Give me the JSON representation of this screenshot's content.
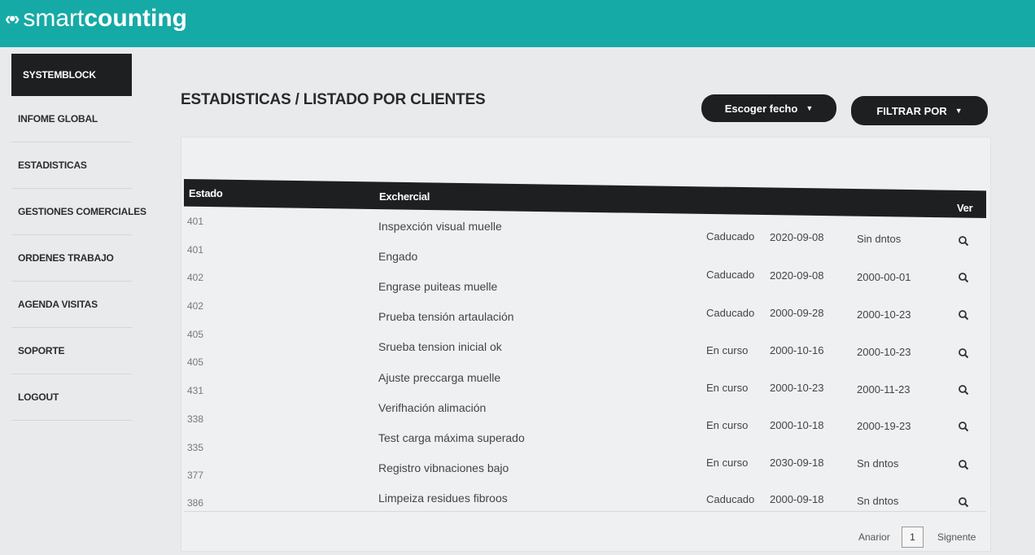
{
  "app": {
    "logo_mark": "‹•›",
    "logo_light": "smart",
    "logo_bold": "counting"
  },
  "sidebar": {
    "items": [
      {
        "label": "SYSTEMBLOCK"
      },
      {
        "label": "INFOME GLOBAL"
      },
      {
        "label": "ESTADISTICAS"
      },
      {
        "label": "GESTIONES COMERCIALES"
      },
      {
        "label": "ORDENES TRABAJO"
      },
      {
        "label": "AGENDA VISITAS"
      },
      {
        "label": "SOPORTE"
      },
      {
        "label": "LOGOUT"
      }
    ]
  },
  "page": {
    "title": "ESTADISTICAS / LISTADO POR CLIENTES",
    "date_button": "Escoger fecho",
    "filter_button": "FILTRAR POR"
  },
  "table": {
    "headers": {
      "estado": "Estado",
      "exchercial": "Exchercial",
      "ver": "Ver"
    },
    "estado_col": [
      "401",
      "401",
      "402",
      "402",
      "405",
      "405",
      "431",
      "338",
      "335",
      "377",
      "386"
    ],
    "exchercial_col": [
      "Inspexción visual muelle",
      "Engado",
      "Engrase puiteas muelle",
      "Prueba tensión artaulación",
      "Srueba tension inicial ok",
      "Ajuste preccarga muelle",
      "Verifhación alimación",
      "Test carga máxima superado",
      "Registro vibnaciones bajo",
      "Limpeiza residues fibroos"
    ],
    "status_rows": [
      {
        "status": "Caducado",
        "date1": "2020-09-08",
        "date2": "Sin dntos"
      },
      {
        "status": "Caducado",
        "date1": "2020-09-08",
        "date2": "2000-00-01"
      },
      {
        "status": "Caducado",
        "date1": "2000-09-28",
        "date2": "2000-10-23"
      },
      {
        "status": "En curso",
        "date1": "2000-10-16",
        "date2": "2000-10-23"
      },
      {
        "status": "En curso",
        "date1": "2000-10-23",
        "date2": "2000-11-23"
      },
      {
        "status": "En curso",
        "date1": "2000-10-18",
        "date2": "2000-19-23"
      },
      {
        "status": "En curso",
        "date1": "2030-09-18",
        "date2": "Sn dntos"
      },
      {
        "status": "Caducado",
        "date1": "2000-09-18",
        "date2": "Sn dntos"
      }
    ]
  },
  "pager": {
    "prev": "Anarior",
    "page": "1",
    "next": "Signente"
  },
  "colors": {
    "topbar": "#16aaa6",
    "dark": "#1d1f21"
  },
  "icons": {
    "row_action": "search-icon",
    "dropdown": "caret-down-icon"
  }
}
